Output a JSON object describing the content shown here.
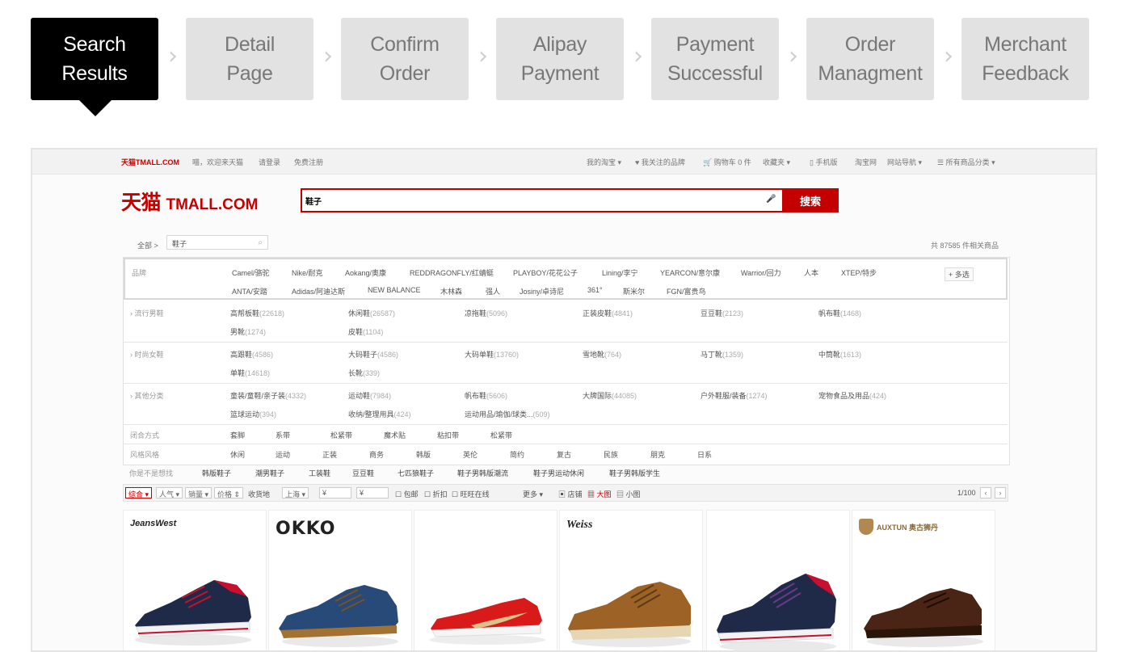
{
  "steps": [
    {
      "line1": "Search",
      "line2": "Results",
      "active": true
    },
    {
      "line1": "Detail",
      "line2": "Page",
      "active": false
    },
    {
      "line1": "Confirm",
      "line2": "Order",
      "active": false
    },
    {
      "line1": "Alipay",
      "line2": "Payment",
      "active": false
    },
    {
      "line1": "Payment",
      "line2": "Successful",
      "active": false
    },
    {
      "line1": "Order",
      "line2": "Managment",
      "active": false
    },
    {
      "line1": "Merchant",
      "line2": "Feedback",
      "active": false
    }
  ],
  "chevron": "›",
  "site": {
    "topnav_left": [
      "天猫TMALL.COM",
      "喵，欢迎来天猫",
      "请登录",
      "免费注册"
    ],
    "topnav_right": [
      "我的淘宝 ▾",
      "♥ 我关注的品牌",
      "🛒 购物车 0 件",
      "收藏夹 ▾",
      "▯ 手机版",
      "淘宝网",
      "网站导航 ▾",
      "☰ 所有商品分类 ▾"
    ],
    "logo_cn": "天猫",
    "logo_en": "TMALL.COM",
    "search_value": "鞋子",
    "mic_icon": "🎤",
    "search_button": "搜索",
    "breadcrumb_all": "全部 >",
    "breadcrumb_value": "鞋子",
    "result_count": "共 87585 件相关商品",
    "brand_label": "品牌",
    "brands_row1": [
      "Camel/骆驼",
      "Nike/耐克",
      "Aokang/奥康",
      "REDDRAGONFLY/红蜻蜓",
      "PLAYBOY/花花公子",
      "Lining/李宁",
      "YEARCON/意尔康",
      "Warrior/回力",
      "人本",
      "XTEP/特步"
    ],
    "brands_row2": [
      "ANTA/安踏",
      "Adidas/阿迪达斯",
      "NEW BALANCE",
      "木林森",
      "强人",
      "Josiny/卓诗尼",
      "361°",
      "斯米尔",
      "FGN/富贵鸟"
    ],
    "more_label": "+ 多选",
    "attr_rows": [
      {
        "label": "› 流行男鞋",
        "items": [
          [
            "高帮板鞋",
            "(22618)"
          ],
          [
            "休闲鞋",
            "(26587)"
          ],
          [
            "凉拖鞋",
            "(5096)"
          ],
          [
            "正装皮鞋",
            "(4841)"
          ],
          [
            "豆豆鞋",
            "(2123)"
          ],
          [
            "帆布鞋",
            "(1468)"
          ],
          [
            "男靴",
            "(1274)"
          ],
          [
            "皮鞋",
            "(1104)"
          ]
        ]
      },
      {
        "label": "› 时尚女鞋",
        "items": [
          [
            "高跟鞋",
            "(4586)"
          ],
          [
            "大码鞋子",
            "(4586)"
          ],
          [
            "大码单鞋",
            "(13760)"
          ],
          [
            "雪地靴",
            "(764)"
          ],
          [
            "马丁靴",
            "(1359)"
          ],
          [
            "中筒靴",
            "(1613)"
          ],
          [
            "单鞋",
            "(14618)"
          ],
          [
            "长靴",
            "(339)"
          ]
        ]
      },
      {
        "label": "› 其他分类",
        "items": [
          [
            "童装/童鞋/亲子装",
            "(4332)"
          ],
          [
            "运动鞋",
            "(7984)"
          ],
          [
            "帆布鞋",
            "(5606)"
          ],
          [
            "大牌国际",
            "(44085)"
          ],
          [
            "户外鞋服/装备",
            "(1274)"
          ],
          [
            "宠物食品及用品",
            "(424)"
          ],
          [
            "篮球运动",
            "(394)"
          ],
          [
            "收纳/整理用具",
            "(424)"
          ],
          [
            "运动用品/瑜伽/球类...",
            "(509)"
          ]
        ]
      }
    ],
    "open_method": {
      "label": "闭合方式",
      "items": [
        "套脚",
        "系带",
        "松紧带",
        "魔术贴",
        "粘扣带",
        "松紧带"
      ]
    },
    "style": {
      "label": "风格风格",
      "items": [
        "休闲",
        "运动",
        "正装",
        "商务",
        "韩版",
        "英伦",
        "简约",
        "复古",
        "民族",
        "朋克",
        "日系"
      ]
    },
    "related": {
      "label": "你是不是想找",
      "items": [
        "韩版鞋子",
        "潮男鞋子",
        "工装鞋",
        "豆豆鞋",
        "七匹狼鞋子",
        "鞋子男韩版潮流",
        "鞋子男运动休闲",
        "鞋子男韩版学生"
      ]
    },
    "filterbar": {
      "sort": [
        "综合 ▾",
        "人气 ▾",
        "销量 ▾",
        "价格 ⇕"
      ],
      "ship_label": "收货地",
      "location": "上海 ▾",
      "price_from": "¥",
      "price_to": "¥",
      "checks": [
        "☐ 包邮",
        "☐ 折扣",
        "☐ 旺旺在线"
      ],
      "more": "更多 ▾",
      "views": [
        "▣ 店铺",
        "▦ 大图",
        "▤ 小图"
      ],
      "page": "1/100",
      "prev": "‹",
      "next": "›"
    },
    "products": [
      {
        "brand": "JeansWest"
      },
      {
        "brand": "OKKO"
      },
      {
        "brand": ""
      },
      {
        "brand": "Weiss"
      },
      {
        "brand": ""
      },
      {
        "brand": "AUXTUN 奥古狮丹"
      }
    ]
  },
  "colors": {
    "accent": "#c40000",
    "step_active": "#000000",
    "step_inactive": "#e2e2e2"
  }
}
